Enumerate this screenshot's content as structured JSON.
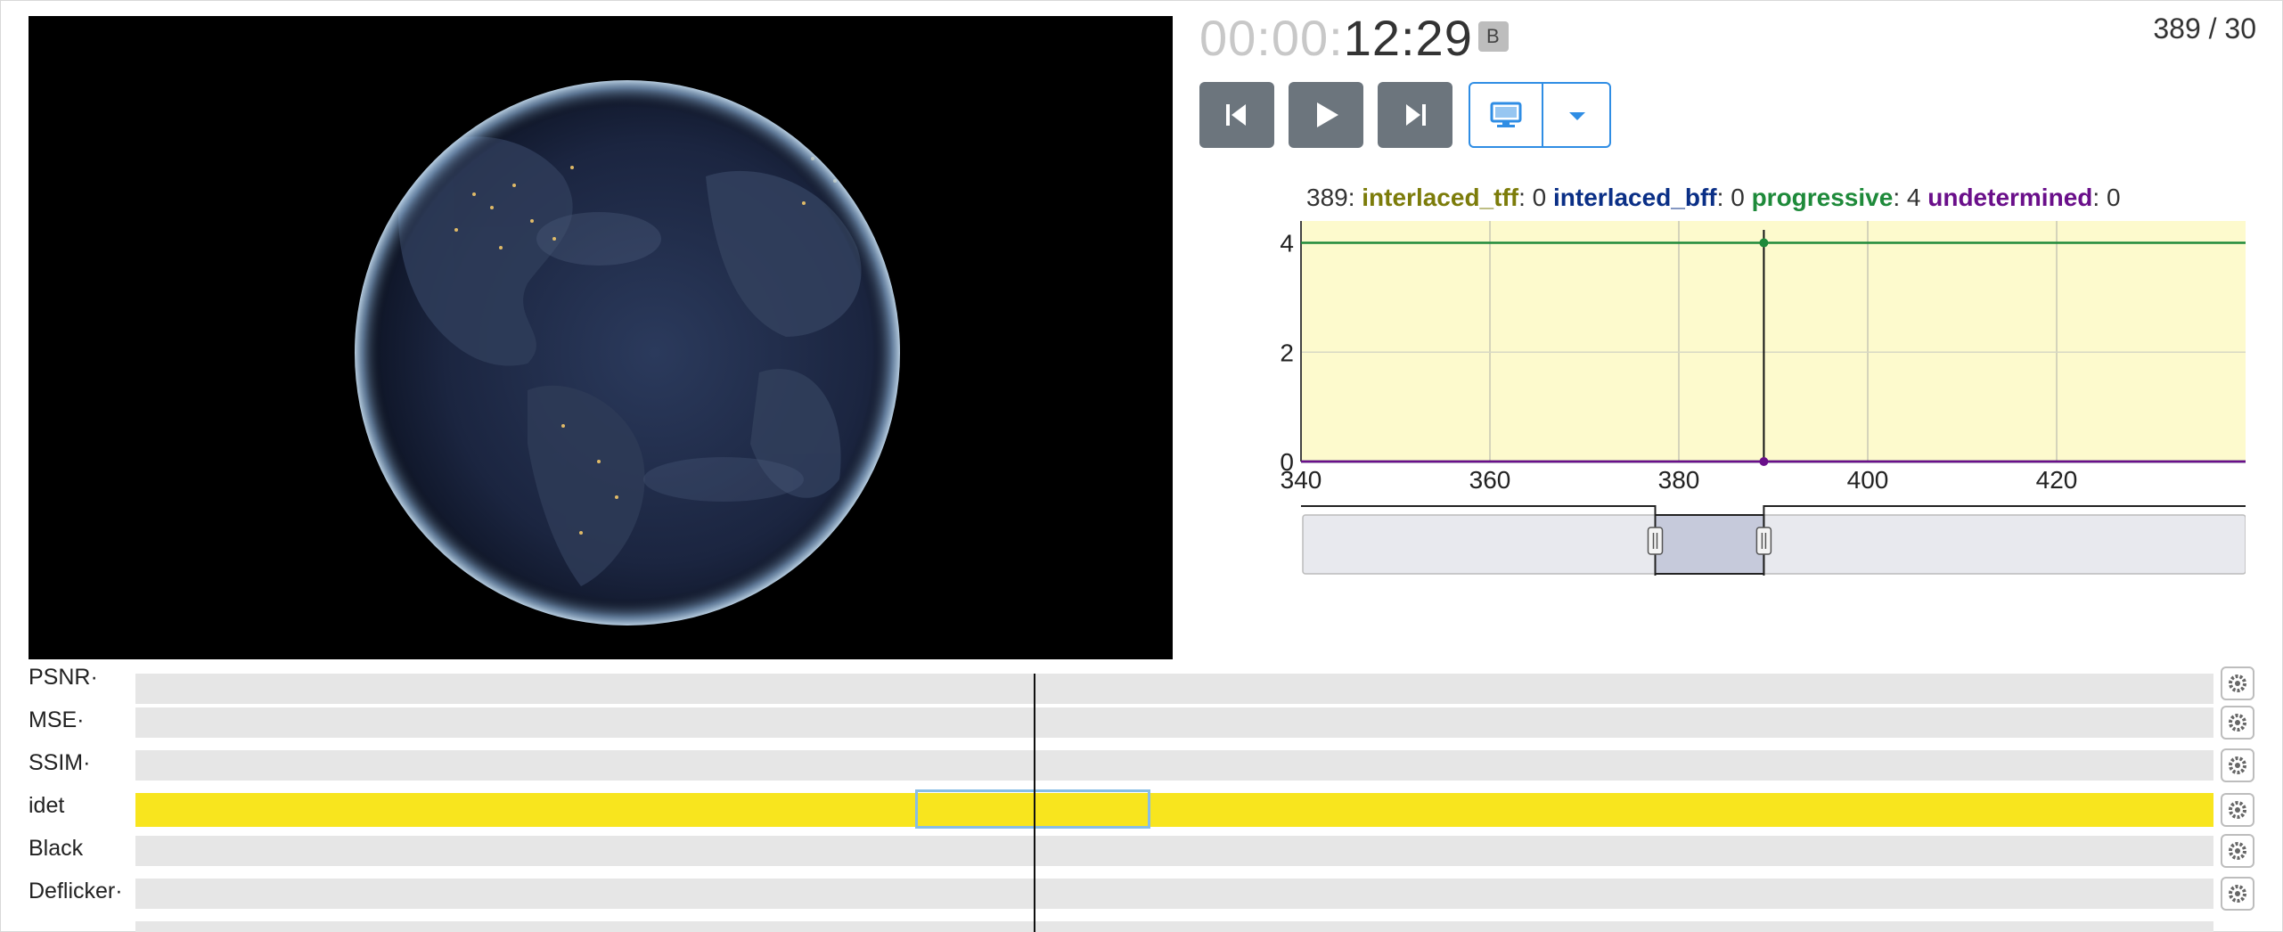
{
  "app": {
    "frame_counter": "389 / 30"
  },
  "timecode": {
    "dim": "00:00:",
    "main": "12:29",
    "badge": "B"
  },
  "controls": {
    "icons": [
      "skip-back-icon",
      "play-icon",
      "skip-forward-icon",
      "monitor-icon",
      "caret-down-icon"
    ],
    "accent": "#2f8de4",
    "button_color": "#6c757d"
  },
  "chart_legend": {
    "frame": "389",
    "items": [
      {
        "name": "interlaced_tff",
        "value": "0",
        "color": "#7c7c0a"
      },
      {
        "name": "interlaced_bff",
        "value": "0",
        "color": "#0a2f86"
      },
      {
        "name": "progressive",
        "value": "4",
        "color": "#1e8a3a"
      },
      {
        "name": "undetermined",
        "value": "0",
        "color": "#6a0f8a"
      }
    ]
  },
  "chart_data": {
    "type": "line",
    "title": "",
    "xlabel": "",
    "ylabel": "",
    "xlim": [
      340,
      440
    ],
    "ylim": [
      0,
      4.4
    ],
    "x_ticks": [
      "340",
      "360",
      "380",
      "400",
      "420"
    ],
    "y_ticks": [
      "0",
      "2",
      "4"
    ],
    "background": "#fdfacd",
    "grid": true,
    "cursor_x": 389,
    "series": [
      {
        "name": "progressive",
        "color": "#1e8a3a",
        "x": [
          340,
          440
        ],
        "values": [
          4,
          4
        ]
      },
      {
        "name": "interlaced_tff",
        "color": "#7c7c0a",
        "x": [
          340,
          440
        ],
        "values": [
          0,
          0
        ]
      },
      {
        "name": "interlaced_bff",
        "color": "#0a2f86",
        "x": [
          340,
          440
        ],
        "values": [
          0,
          0
        ]
      },
      {
        "name": "undetermined",
        "color": "#6a0f8a",
        "x": [
          340,
          440
        ],
        "values": [
          0,
          0
        ]
      }
    ],
    "range_selector": {
      "from": 377.5,
      "to": 389
    }
  },
  "filters": {
    "rows": [
      {
        "label": "PSNR·",
        "highlight": false
      },
      {
        "label": "MSE·",
        "highlight": false
      },
      {
        "label": "SSIM·",
        "highlight": false
      },
      {
        "label": "idet",
        "highlight": true
      },
      {
        "label": "Black",
        "highlight": false
      },
      {
        "label": "Deflicker·",
        "highlight": false
      }
    ],
    "settings_icon": "gear-icon",
    "highlight_color": "#f8e51e"
  }
}
